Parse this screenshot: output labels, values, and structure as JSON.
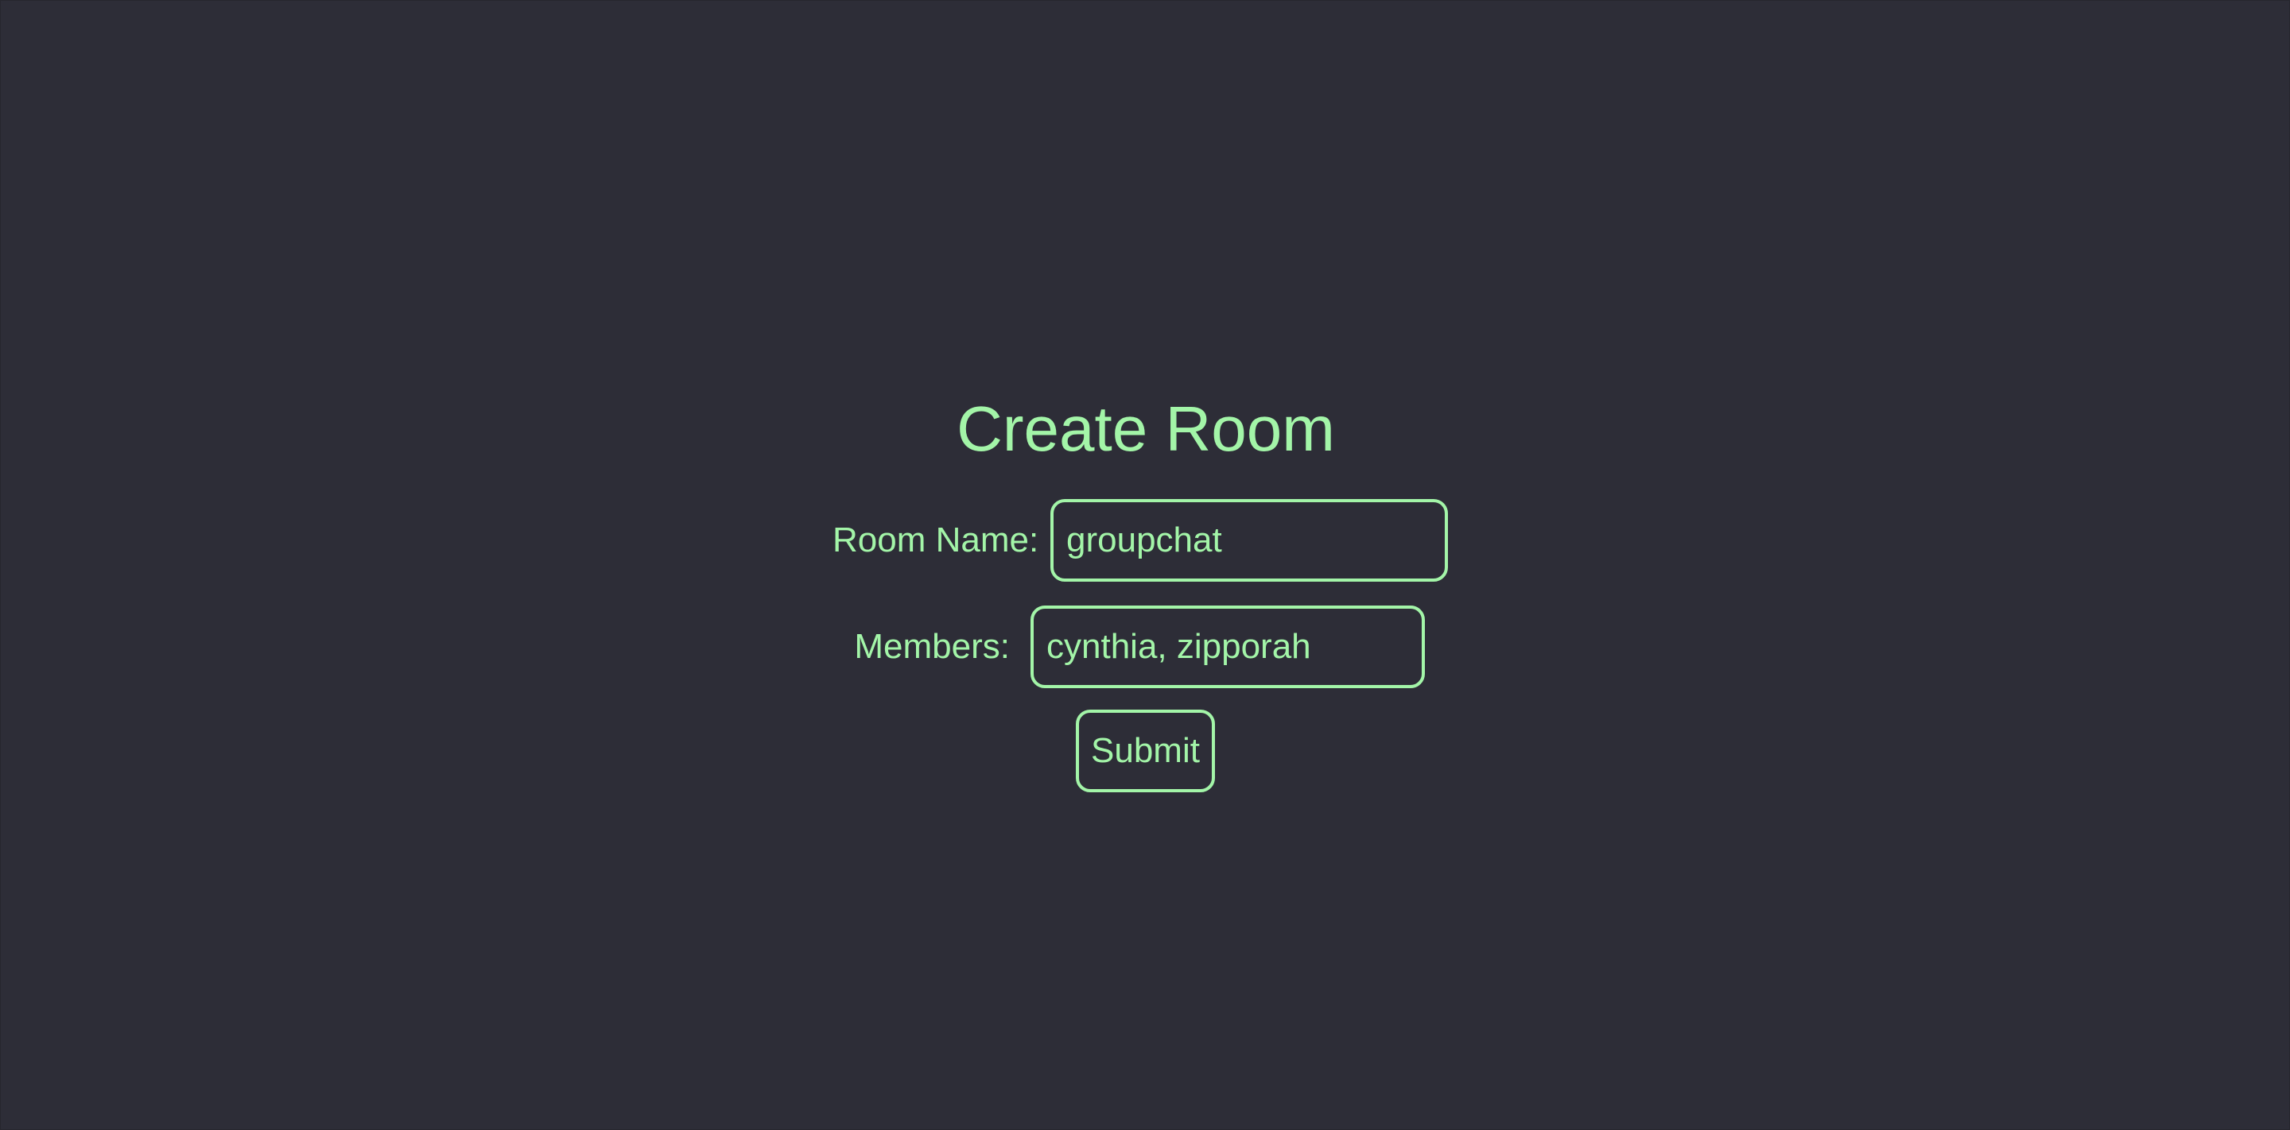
{
  "title": "Create Room",
  "form": {
    "room_name_label": "Room Name:",
    "room_name_value": "groupchat",
    "members_label": "Members:",
    "members_value": "cynthia, zipporah",
    "submit_label": "Submit"
  },
  "colors": {
    "background": "#2d2d37",
    "accent": "#a3f5a8"
  }
}
